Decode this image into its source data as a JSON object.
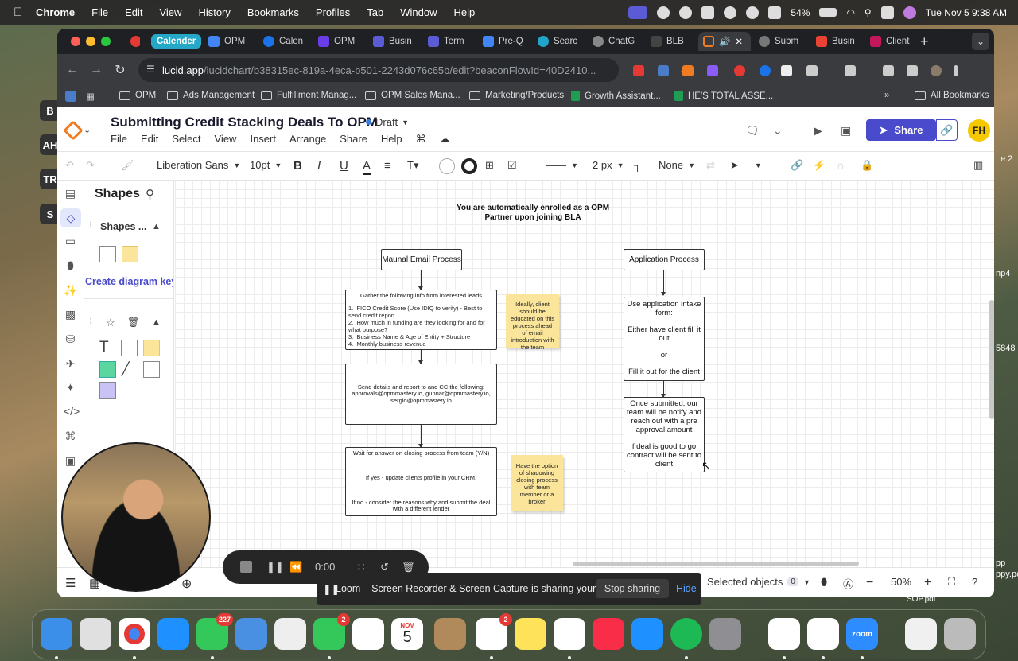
{
  "menubar": {
    "app_name": "Chrome",
    "items": [
      "File",
      "Edit",
      "View",
      "History",
      "Bookmarks",
      "Profiles",
      "Tab",
      "Window",
      "Help"
    ],
    "battery": "54%",
    "datetime": "Tue Nov 5  9:38 AM"
  },
  "tabs": {
    "group_label": "Calender",
    "items": [
      "OPM",
      "Calen",
      "OPM",
      "Busin",
      "Term",
      "Pre-Q",
      "Searc",
      "ChatG",
      "BLB",
      "",
      "Subm",
      "Busin",
      "Client"
    ]
  },
  "toolbar": {
    "url_host": "lucid.app",
    "url_path": "/lucidchart/b38315ec-819a-4eca-b501-2243d076c65b/edit?beaconFlowId=40D2410..."
  },
  "bookmarks": {
    "items": [
      "OPM",
      "Ads Management",
      "Fulfillment Manag...",
      "OPM Sales Mana...",
      "Marketing/Products",
      "Growth Assistant...",
      "HE'S TOTAL ASSE..."
    ],
    "all_label": "All Bookmarks",
    "more": "»"
  },
  "lucid": {
    "title": "Submitting Credit Stacking Deals To OPM",
    "status": "Draft",
    "menu": [
      "File",
      "Edit",
      "Select",
      "View",
      "Insert",
      "Arrange",
      "Share",
      "Help"
    ],
    "share_label": "Share",
    "avatar_initials": "FH",
    "format": {
      "font": "Liberation Sans",
      "font_size": "10pt",
      "line_width": "2 px",
      "endpoint": "None"
    },
    "panel": {
      "title": "Shapes",
      "section": "Shapes ...",
      "diagram_key": "Create diagram key"
    },
    "status_bar": {
      "selected_label": "Selected objects",
      "selected_count": "0",
      "zoom": "50%"
    }
  },
  "diagram": {
    "header_note": "You are automatically enrolled as a OPM Partner upon joining BLA",
    "left_title": "Maunal Email Process",
    "right_title": "Application Process",
    "gather_title": "Gather the following info from interested leads",
    "gather_items": [
      "FICO Credit Score (Use IDIQ to verify) - Best to send credit report",
      "How much in funding are they looking for and for what purpose?",
      "Business Name & Age of Entity + Structure",
      "Monthly business revenue"
    ],
    "send_details": "Send details and report to and CC the following:",
    "send_emails": "approvals@opmmastery.io, gunnar@opmmastery.io, sergio@opmmastery.io",
    "wait_title": "Wait for answer on closing process from team (Y/N)",
    "wait_yes": "If yes - update clients profile in your CRM.",
    "wait_no": "If no - consider the reasons why and submit the deal with a different lender",
    "sticky1": "Ideally, client should be educated on this process ahead of email introduction with the team",
    "sticky2": "Have the option of shadowing closing process with team member or a broker",
    "intake_1": "Use application intake form:",
    "intake_2": "Either have client fill it out",
    "intake_or": "or",
    "intake_3": "Fill it out for the client",
    "submitted_1": "Once submitted, our team will be notify and reach out with a pre approval amount",
    "submitted_2": "If deal is good to go, contract will be sent to client"
  },
  "loom": {
    "timer": "0:00",
    "share_message": "Loom – Screen Recorder & Screen Capture is sharing your screen.",
    "stop_label": "Stop sharing",
    "hide_label": "Hide"
  },
  "desktop": {
    "file_label": "SOP.pdf",
    "left_labels": [
      "B",
      "AH",
      "TR",
      "S"
    ],
    "right_labels": [
      "e 2",
      "np4",
      "5848",
      "pp",
      "ppy.pc"
    ]
  },
  "dock": {
    "calendar_month": "NOV",
    "calendar_day": "5",
    "badges": {
      "messages": "227",
      "facetime": "2",
      "reminders": "2"
    },
    "zoom_label": "zoom"
  }
}
